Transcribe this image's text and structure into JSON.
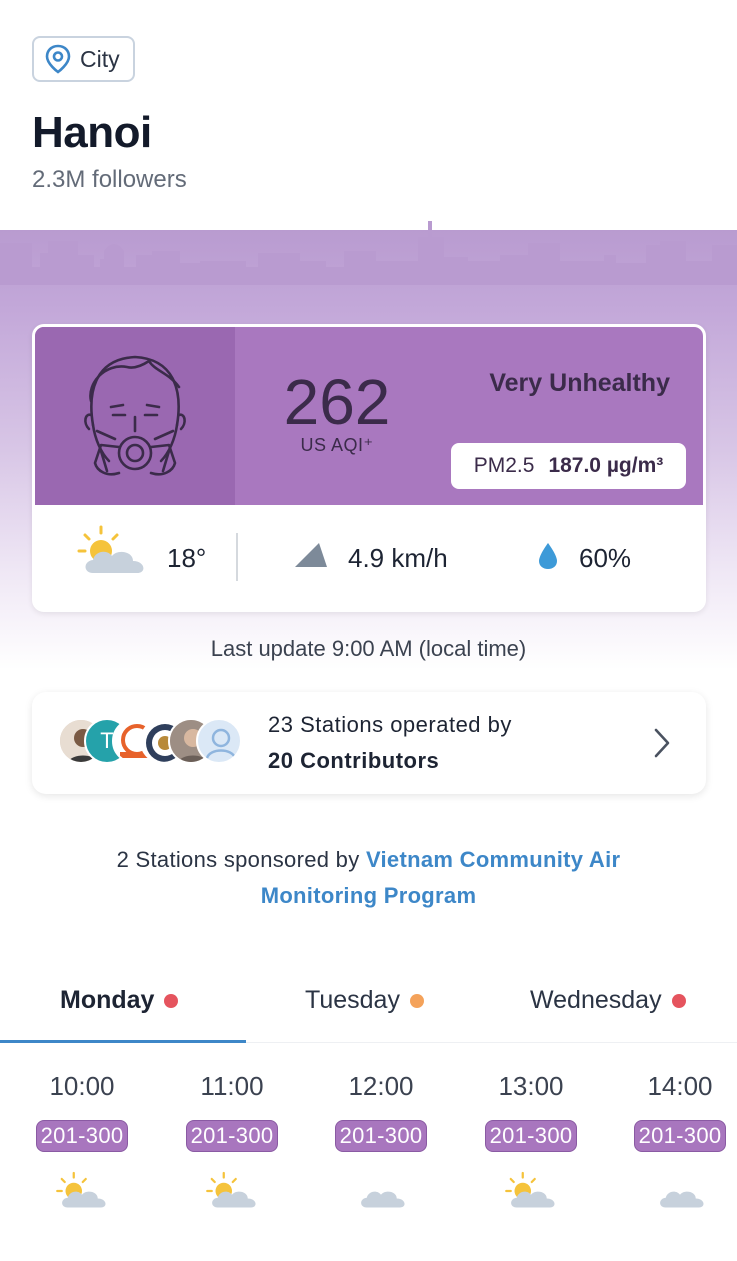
{
  "header": {
    "chip_label": "City",
    "city": "Hanoi",
    "followers": "2.3M followers"
  },
  "aqi": {
    "value": "262",
    "unit": "US AQI⁺",
    "status": "Very Unhealthy",
    "pollutant": "PM2.5",
    "concentration": "187.0 µg/m³",
    "level_color": "#a978bf"
  },
  "weather": {
    "temperature": "18°",
    "wind": "4.9 km/h",
    "humidity": "60%"
  },
  "last_update": "Last update 9:00 AM (local time)",
  "contributors": {
    "line1": "23 Stations operated by",
    "line2": "20 Contributors",
    "avatar_initial": "T"
  },
  "sponsor": {
    "prefix": "2 Stations sponsored by ",
    "program": "Vietnam Community Air Monitoring Program"
  },
  "forecast": {
    "tabs": [
      {
        "label": "Monday",
        "dot_color": "#e5545e",
        "selected": true
      },
      {
        "label": "Tuesday",
        "dot_color": "#f4a25a",
        "selected": false
      },
      {
        "label": "Wednesday",
        "dot_color": "#e5545e",
        "selected": false
      }
    ],
    "hours": [
      {
        "time": "10:00",
        "aqi_range": "201-300",
        "icon": "sun-cloud-icon"
      },
      {
        "time": "11:00",
        "aqi_range": "201-300",
        "icon": "sun-cloud-icon"
      },
      {
        "time": "12:00",
        "aqi_range": "201-300",
        "icon": "cloud-icon"
      },
      {
        "time": "13:00",
        "aqi_range": "201-300",
        "icon": "sun-cloud-icon"
      },
      {
        "time": "14:00",
        "aqi_range": "201-300",
        "icon": "cloud-icon"
      }
    ]
  }
}
